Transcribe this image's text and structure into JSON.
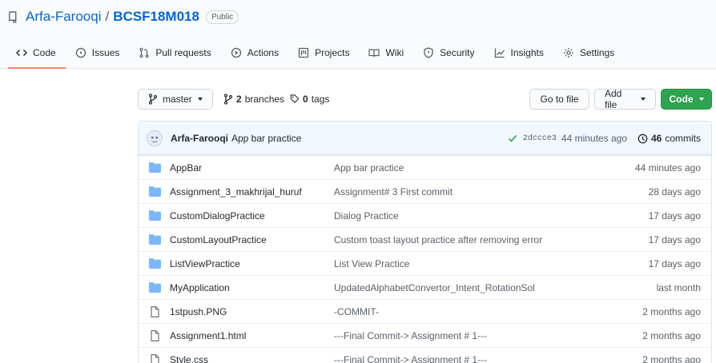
{
  "repo": {
    "owner": "Arfa-Farooqi",
    "separator": "/",
    "name": "BCSF18M018",
    "visibility": "Public"
  },
  "tabs": [
    {
      "label": "Code",
      "icon": "code-icon",
      "active": true
    },
    {
      "label": "Issues",
      "icon": "issue-icon"
    },
    {
      "label": "Pull requests",
      "icon": "pull-request-icon"
    },
    {
      "label": "Actions",
      "icon": "play-icon"
    },
    {
      "label": "Projects",
      "icon": "project-icon"
    },
    {
      "label": "Wiki",
      "icon": "book-icon"
    },
    {
      "label": "Security",
      "icon": "shield-icon"
    },
    {
      "label": "Insights",
      "icon": "graph-icon"
    },
    {
      "label": "Settings",
      "icon": "gear-icon"
    }
  ],
  "toolbar": {
    "branch": "master",
    "branches_count": "2",
    "branches_label": "branches",
    "tags_count": "0",
    "tags_label": "tags",
    "goto_file": "Go to file",
    "add_file": "Add file",
    "code": "Code"
  },
  "commit": {
    "author": "Arfa-Farooqi",
    "message": "App bar practice",
    "sha": "2dccce3",
    "age": "44 minutes ago",
    "count": "46",
    "count_label": "commits"
  },
  "files": [
    {
      "type": "folder",
      "name": "AppBar",
      "message": "App bar practice",
      "age": "44 minutes ago"
    },
    {
      "type": "folder",
      "name": "Assignment_3_makhrijal_huruf",
      "message": "Assignment# 3 First commit",
      "age": "28 days ago"
    },
    {
      "type": "folder",
      "name": "CustomDialogPractice",
      "message": "Dialog Practice",
      "age": "17 days ago"
    },
    {
      "type": "folder",
      "name": "CustomLayoutPractice",
      "message": "Custom toast layout practice after removing error",
      "age": "17 days ago"
    },
    {
      "type": "folder",
      "name": "ListViewPractice",
      "message": "List View Practice",
      "age": "17 days ago"
    },
    {
      "type": "folder",
      "name": "MyApplication",
      "message": "UpdatedAlphabetConvertor_Intent_RotationSol",
      "age": "last month"
    },
    {
      "type": "file",
      "name": "1stpush.PNG",
      "message": "-COMMIT-",
      "age": "2 months ago"
    },
    {
      "type": "file",
      "name": "Assignment1.html",
      "message": "---Final Commit-> Assignment # 1---",
      "age": "2 months ago"
    },
    {
      "type": "file",
      "name": "Style.css",
      "message": "---Final Commit-> Assignment # 1---",
      "age": "2 months ago"
    }
  ],
  "colors": {
    "link": "#0366d6",
    "primary_button": "#2ea44f",
    "active_tab_underline": "#f9826c",
    "folder": "#79b8ff",
    "commit_bar": "#f1f8ff"
  }
}
